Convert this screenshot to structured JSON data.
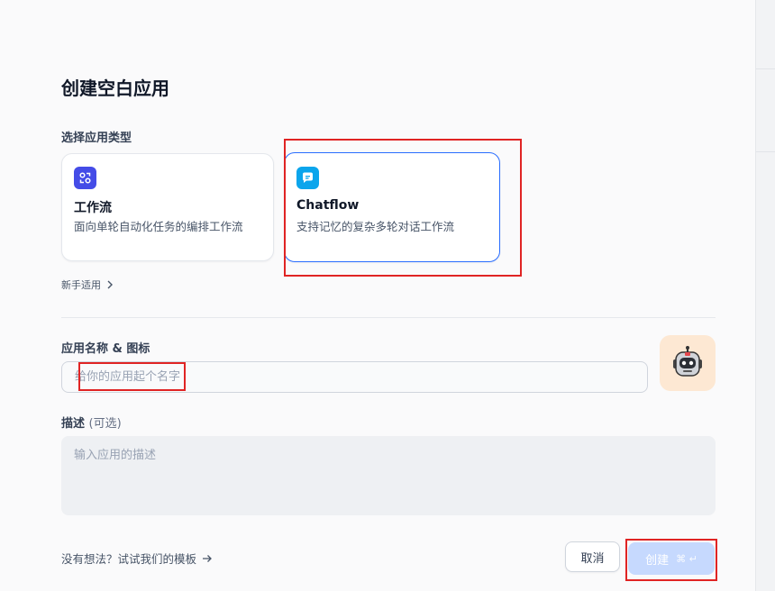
{
  "dialog": {
    "title": "创建空白应用"
  },
  "app_type": {
    "label": "选择应用类型",
    "options": [
      {
        "name": "工作流",
        "description": "面向单轮自动化任务的编排工作流",
        "icon": "workflow-icon",
        "color": "#444ce7",
        "selected": false
      },
      {
        "name": "Chatflow",
        "description": "支持记忆的复杂多轮对话工作流",
        "icon": "chat-bubble-icon",
        "color": "#0ba5ec",
        "selected": true
      }
    ],
    "beginner_link": "新手适用"
  },
  "name_section": {
    "label": "应用名称 & 图标",
    "placeholder": "给你的应用起个名字",
    "icon": "robot-icon",
    "icon_bg": "#fde8d3"
  },
  "description_section": {
    "label": "描述",
    "optional": "(可选)",
    "placeholder": "输入应用的描述"
  },
  "footer": {
    "template_link": "没有想法？试试我们的模板",
    "cancel_label": "取消",
    "create_label": "创建",
    "create_shortcut": "⌘ ↵"
  },
  "colors": {
    "accent": "#296dff",
    "highlight": "#e02424"
  }
}
